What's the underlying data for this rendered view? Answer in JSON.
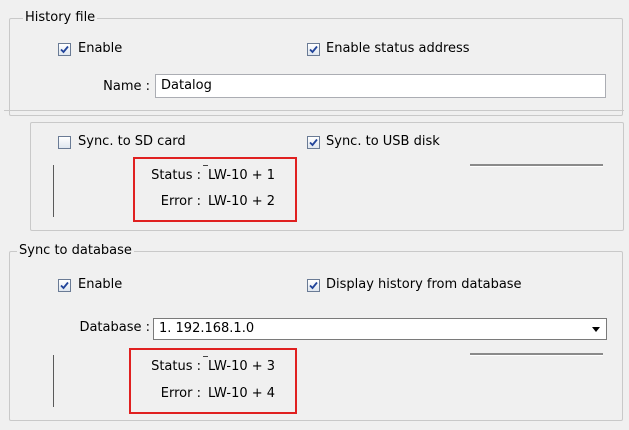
{
  "history_file": {
    "legend": "History file",
    "enable_label": "Enable",
    "enable_checked": true,
    "enable_status_label": "Enable status address",
    "enable_status_checked": true,
    "name_label": "Name :",
    "name_value": "Datalog"
  },
  "sync_storage": {
    "sd_label": "Sync. to SD card",
    "sd_checked": false,
    "usb_label": "Sync. to USB disk",
    "usb_checked": true,
    "status_label": "Status :",
    "status_value": "LW-10 + 1",
    "error_label": "Error :",
    "error_value": "LW-10 + 2"
  },
  "sync_database": {
    "legend": "Sync to database",
    "enable_label": "Enable",
    "enable_checked": true,
    "display_history_label": "Display history from database",
    "display_history_checked": true,
    "database_label": "Database :",
    "database_value": "1. 192.168.1.0",
    "status_label": "Status :",
    "status_value": "LW-10 + 3",
    "error_label": "Error :",
    "error_value": "LW-10 + 4"
  },
  "colors": {
    "highlight_box": "#e02020",
    "checkbox_border": "#6a7b95",
    "checkmark": "#21449a"
  }
}
